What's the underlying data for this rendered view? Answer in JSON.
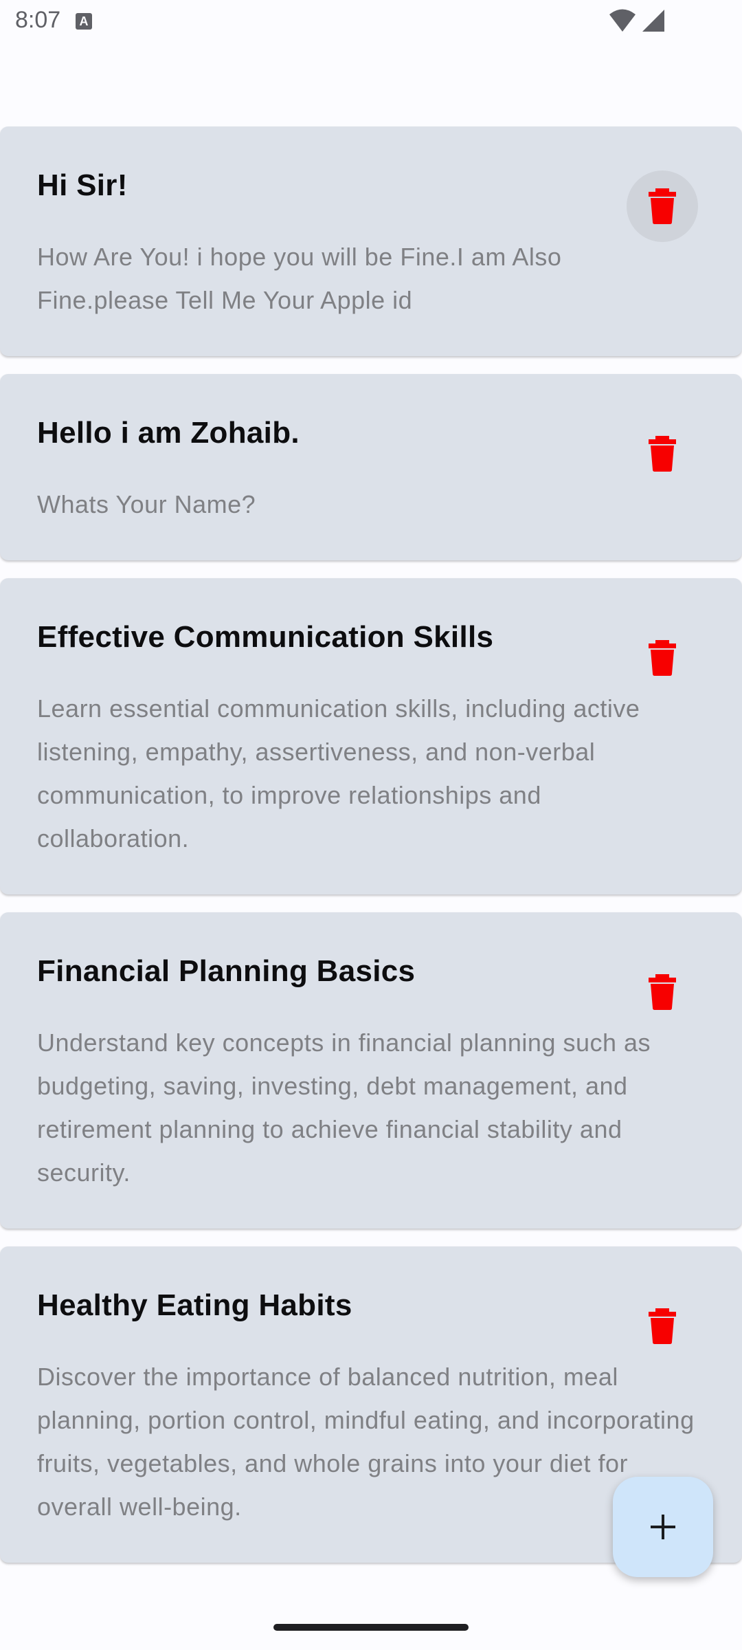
{
  "status_bar": {
    "time": "8:07",
    "notification_icon": "A"
  },
  "notes": [
    {
      "title": "Hi Sir!",
      "body": "How Are You! i hope you will be Fine.I am Also Fine.please Tell Me Your Apple id",
      "delete_pressed": true
    },
    {
      "title": "Hello i am Zohaib.",
      "body": "Whats Your Name?"
    },
    {
      "title": "Effective Communication Skills",
      "body": " Learn essential communication skills, including active listening, empathy, assertiveness, and non-verbal communication, to improve relationships and collaboration."
    },
    {
      "title": "Financial Planning Basics",
      "body": "Understand key concepts in financial planning such as budgeting, saving, investing, debt management, and retirement planning to achieve financial stability and security."
    },
    {
      "title": "Healthy Eating Habits",
      "body": "Discover the importance of balanced nutrition, meal planning, portion control, mindful eating, and incorporating fruits, vegetables, and whole grains into your diet for overall well-being."
    }
  ],
  "icons": {
    "delete": "trash-icon",
    "add": "plus-icon"
  },
  "colors": {
    "card_background": "#dce1e9",
    "delete_icon": "#f70000",
    "fab_background": "#cfe5fa",
    "title_text": "#0d0d0f",
    "body_text": "#7f8084"
  }
}
